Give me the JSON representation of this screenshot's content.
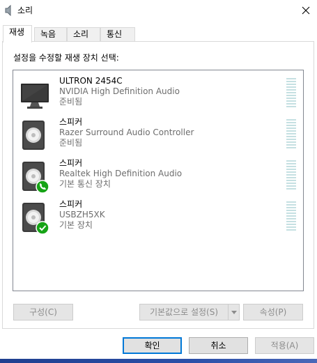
{
  "window": {
    "title": "소리"
  },
  "tabs": [
    {
      "label": "재생",
      "active": true
    },
    {
      "label": "녹음",
      "active": false
    },
    {
      "label": "소리",
      "active": false
    },
    {
      "label": "통신",
      "active": false
    }
  ],
  "instruction": "설정을 수정할 재생 장치 선택:",
  "devices": [
    {
      "name": "ULTRON 2454C",
      "description": "NVIDIA High Definition Audio",
      "status": "준비됨",
      "icon": "monitor-icon",
      "badge": ""
    },
    {
      "name": "스피커",
      "description": "Razer Surround Audio Controller",
      "status": "준비됨",
      "icon": "speaker-icon",
      "badge": ""
    },
    {
      "name": "스피커",
      "description": "Realtek High Definition Audio",
      "status": "기본 통신 장치",
      "icon": "speaker-icon",
      "badge": "phone-badge-icon"
    },
    {
      "name": "스피커",
      "description": "USBZH5XK",
      "status": "기본 장치",
      "icon": "speaker-icon",
      "badge": "check-badge-icon"
    }
  ],
  "panel_buttons": {
    "configure": "구성(C)",
    "set_default": "기본값으로 설정(S)",
    "properties": "속성(P)"
  },
  "footer": {
    "ok": "확인",
    "cancel": "취소",
    "apply": "적용(A)"
  },
  "colors": {
    "accent": "#0078d7",
    "badge_green": "#16a316",
    "meter": "#c5e0e2"
  }
}
